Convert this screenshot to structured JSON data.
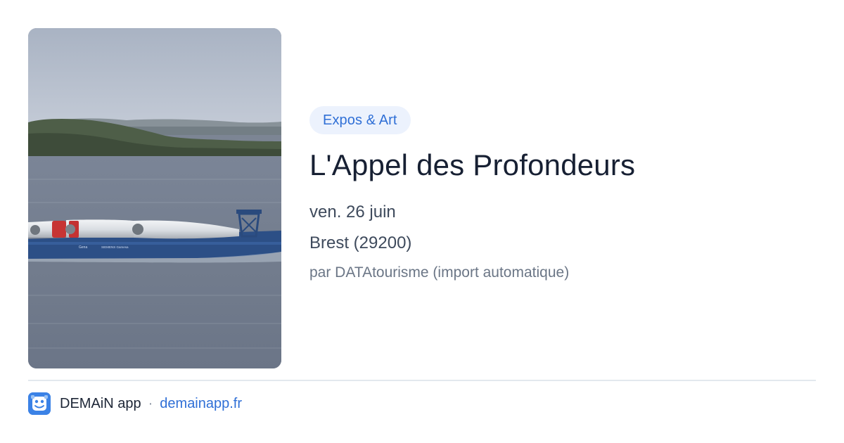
{
  "event": {
    "category": "Expos & Art",
    "title": "L'Appel des Profondeurs",
    "date": "ven. 26 juin",
    "location": "Brest (29200)",
    "source": "par DATAtourisme (import automatique)"
  },
  "footer": {
    "app_name": "DEMAiN app",
    "separator": "·",
    "link_text": "demainapp.fr"
  },
  "image": {
    "alt": "Navire transportant des pales d'éolienne en rade de Brest",
    "ship_text_left": "Gena",
    "ship_text_right": "SIEMENS Gamesa"
  },
  "colors": {
    "accent": "#2f6fd6",
    "chip_bg": "#ecf2fd",
    "title": "#172033",
    "muted": "#6b7686",
    "divider": "#e3e8ee",
    "logo_bg": "#3b82e6"
  },
  "icons": {
    "app_logo": "demain-logo-icon"
  }
}
